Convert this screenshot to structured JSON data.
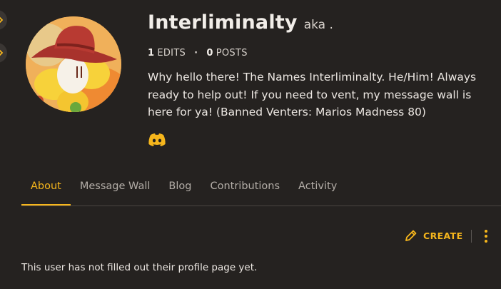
{
  "profile": {
    "username": "Interliminalty",
    "aka": "aka .",
    "stats": {
      "edits_count": "1",
      "edits_label": "EDITS",
      "posts_count": "0",
      "posts_label": "POSTS",
      "separator": "·"
    },
    "bio": "Why hello there! The Names Interliminalty. He/Him! Always ready to help out! If you need to vent, my message wall is here for ya! (Banned Venters: Marios Madness 80)",
    "social_icon": "discord-icon"
  },
  "tabs": [
    {
      "label": "About",
      "active": true
    },
    {
      "label": "Message Wall",
      "active": false
    },
    {
      "label": "Blog",
      "active": false
    },
    {
      "label": "Contributions",
      "active": false
    },
    {
      "label": "Activity",
      "active": false
    }
  ],
  "actions": {
    "create_label": "CREATE",
    "create_icon": "pencil-icon",
    "more_icon": "kebab-menu-icon"
  },
  "content": {
    "empty_message": "This user has not filled out their profile page yet."
  },
  "colors": {
    "background": "#252220",
    "accent": "#f6b61c",
    "text": "#ece7e2",
    "muted": "#b3ada7"
  }
}
